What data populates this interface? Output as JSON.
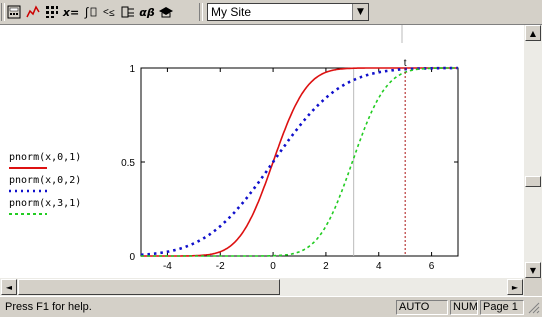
{
  "toolbar": {
    "buttons": [
      {
        "icon": "calculator-toolbar-icon"
      },
      {
        "icon": "graph-toolbar-icon"
      },
      {
        "icon": "matrix-toolbar-icon"
      },
      {
        "icon": "evaluation-toolbar-icon",
        "label": "x="
      },
      {
        "icon": "calculus-toolbar-icon"
      },
      {
        "icon": "boolean-toolbar-icon"
      },
      {
        "icon": "programming-toolbar-icon"
      },
      {
        "icon": "greek-toolbar-icon",
        "label": "αβ"
      },
      {
        "icon": "symbolic-toolbar-icon"
      }
    ],
    "resource_combo": {
      "value": "My Site"
    }
  },
  "legend": [
    {
      "expr": "pnorm(x,0,1)",
      "color": "#dd1111",
      "style": "solid"
    },
    {
      "expr": "pnorm(x,0,2)",
      "color": "#1111cc",
      "style": "dotted"
    },
    {
      "expr": "pnorm(x,3,1)",
      "color": "#22cc22",
      "style": "dashed"
    }
  ],
  "chart_data": {
    "type": "line",
    "xlim": [
      -5,
      7
    ],
    "ylim": [
      0,
      1
    ],
    "x_ticks": [
      "-4",
      "-2",
      "0",
      "2",
      "4",
      "6"
    ],
    "y_ticks": [
      "0",
      "0.5",
      "1"
    ],
    "series": [
      {
        "name": "pnorm(x,0,1)",
        "mean": 0,
        "sd": 1,
        "color": "#dd1111",
        "style": "solid"
      },
      {
        "name": "pnorm(x,0,2)",
        "mean": 0,
        "sd": 2,
        "color": "#1111cc",
        "style": "dotted"
      },
      {
        "name": "pnorm(x,3,1)",
        "mean": 3,
        "sd": 1,
        "color": "#22cc22",
        "style": "dashed"
      }
    ],
    "marker_x": 5,
    "marker_label": "t"
  },
  "status": {
    "help": "Press F1 for help.",
    "mode": "AUTO",
    "num": "NUM",
    "page": "Page 1"
  }
}
